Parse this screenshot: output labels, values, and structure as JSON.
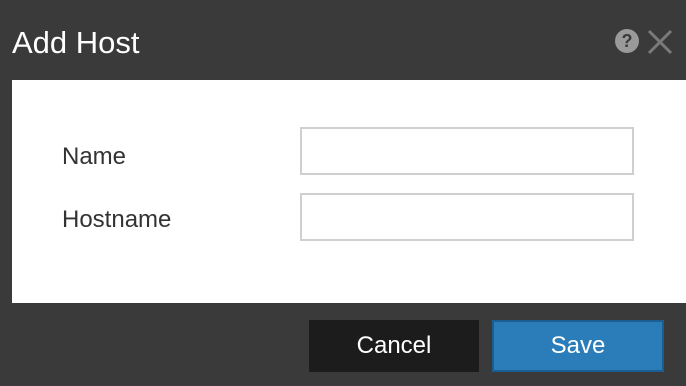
{
  "dialog": {
    "title": "Add Host",
    "help_icon_glyph": "?",
    "fields": [
      {
        "label": "Name",
        "value": "",
        "placeholder": ""
      },
      {
        "label": "Hostname",
        "value": "",
        "placeholder": ""
      }
    ],
    "buttons": {
      "cancel": "Cancel",
      "save": "Save"
    }
  },
  "icons": {
    "help": "help-circle-icon",
    "close": "close-icon"
  },
  "colors": {
    "chrome": "#3a3a3b",
    "content": "#ffffff",
    "cancel_bg": "#1c1c1d",
    "save_bg": "#2a7db8"
  }
}
